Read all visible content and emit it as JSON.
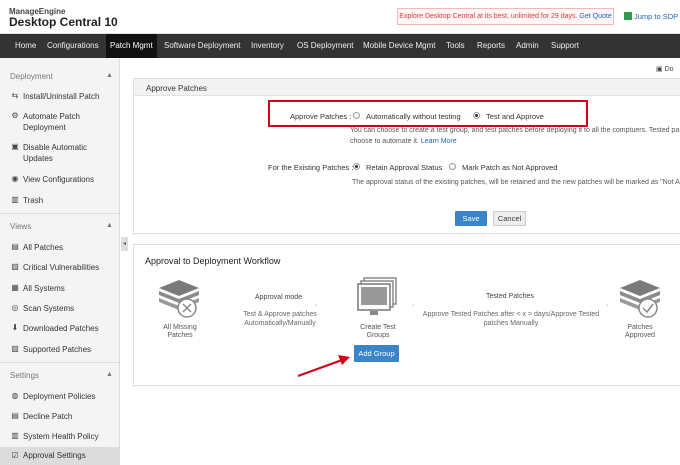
{
  "header": {
    "brand_small": "ManageEngine",
    "brand_big": "Desktop Central 10",
    "promo_text": "Explore Desktop Central at its best, unlimited for 29 days.",
    "promo_link": "Get Quote",
    "sdp_link": "Jump to SDP"
  },
  "nav": {
    "items": [
      "Home",
      "Configurations",
      "Patch Mgmt",
      "Software Deployment",
      "Inventory",
      "OS Deployment",
      "Mobile Device Mgmt",
      "Tools",
      "Reports",
      "Admin",
      "Support"
    ],
    "active": "Patch Mgmt"
  },
  "sidebar": {
    "sections": [
      {
        "title": "Deployment",
        "items": [
          "Install/Uninstall Patch",
          "Automate Patch Deployment",
          "Disable Automatic Updates",
          "View Configurations",
          "Trash"
        ]
      },
      {
        "title": "Views",
        "items": [
          "All Patches",
          "Critical Vulnerabilities",
          "All Systems",
          "Scan Systems",
          "Downloaded Patches",
          "Supported Patches"
        ]
      },
      {
        "title": "Settings",
        "items": [
          "Deployment Policies",
          "Decline Patch",
          "System Health Policy",
          "Approval Settings"
        ]
      }
    ],
    "active_item": "Approval Settings"
  },
  "doc_link": "Do",
  "approve_panel": {
    "title": "Approve Patches",
    "approve_label": "Approve Patches :",
    "option_auto": "Automatically without testing",
    "option_test": "Test and Approve",
    "selected": "Test and Approve",
    "desc_line1": "You can choose to create a test group, and test patches before deploying it to all the comptuers. Tested pa",
    "desc_line2": "choose to automate it.",
    "learn_more": "Learn More",
    "existing_label": "For the Existing Patches :",
    "option_retain": "Retain Approval Status",
    "option_mark": "Mark Patch as Not Approved",
    "existing_selected": "Retain Approval Status",
    "existing_desc": "The approval status of the existing patches, will be retained and the new patches will be marked as \"Not A",
    "save": "Save",
    "cancel": "Cancel"
  },
  "workflow": {
    "title": "Approval to Deployment Workflow",
    "step1": "All Missing Patches",
    "mode_title": "Approval mode",
    "mode_desc": "Test & Approve patches Automatically/Manually",
    "step2": "Create Test Groups",
    "add_group": "Add Group",
    "tested_title": "Tested Patches",
    "tested_desc": "Approve Tested Patches after < x > days/Approve Tested patches Manually",
    "step3": "Patches Approved"
  }
}
